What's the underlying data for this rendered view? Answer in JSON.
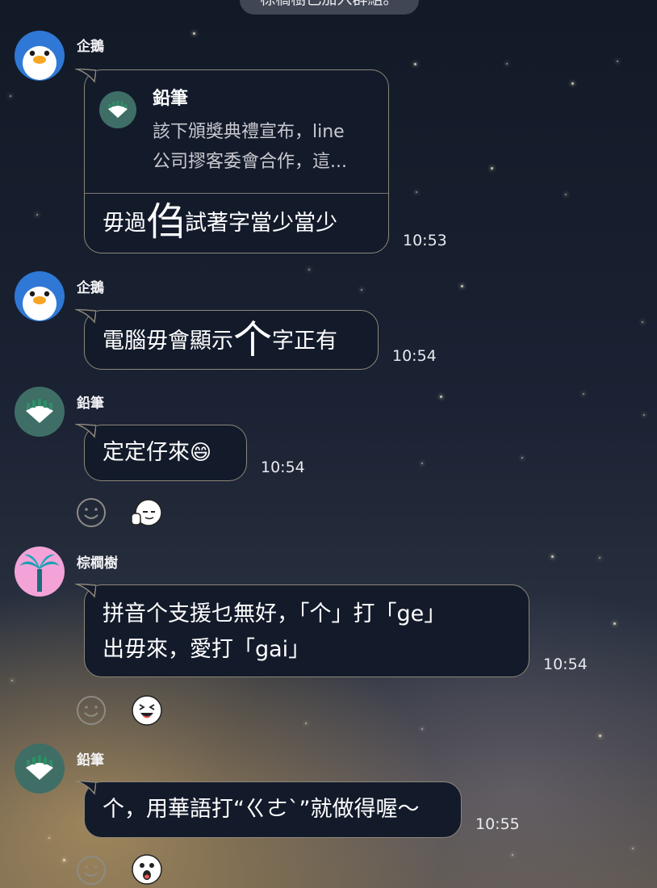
{
  "system_message": "棕櫚樹已加入群組。",
  "messages": [
    {
      "sender": "企鵝",
      "avatar_icon": "penguin-icon",
      "reply": {
        "name": "鉛筆",
        "preview_line1": "該下頒獎典禮宣布，line",
        "preview_line2": "公司摎客委會合作，這..."
      },
      "text_before": "毋過",
      "big_char": "㑇",
      "text_after": "試著字當少當少",
      "time": "10:53"
    },
    {
      "sender": "企鵝",
      "avatar_icon": "penguin-icon",
      "text_before": "電腦毋會顯示",
      "big_char": "个",
      "text_after": "字正有",
      "time": "10:54"
    },
    {
      "sender": "鉛筆",
      "avatar_icon": "pencil-icon",
      "text": "定定仔來",
      "emoji": "😄",
      "time": "10:54",
      "reaction_icon": "thumbs-up-face-icon"
    },
    {
      "sender": "棕櫚樹",
      "avatar_icon": "palm-tree-icon",
      "line1": "拼音个支援乜無好，「个」打「ge」",
      "line2": "出毋來，愛打「gai」",
      "time": "10:54",
      "reaction_icon": "laughing-face-icon"
    },
    {
      "sender": "鉛筆",
      "avatar_icon": "pencil-icon",
      "text": "个，用華語打“ㄍㄜˋ”就做得喔～",
      "time": "10:55",
      "reaction_icon": "surprised-face-icon"
    }
  ],
  "colors": {
    "bubble_bg": "#131b2b",
    "bubble_border": "#8e8679",
    "penguin_avatar": "#2f78d6",
    "pencil_avatar": "#3f6e66",
    "palm_avatar": "#f3a3d8"
  }
}
